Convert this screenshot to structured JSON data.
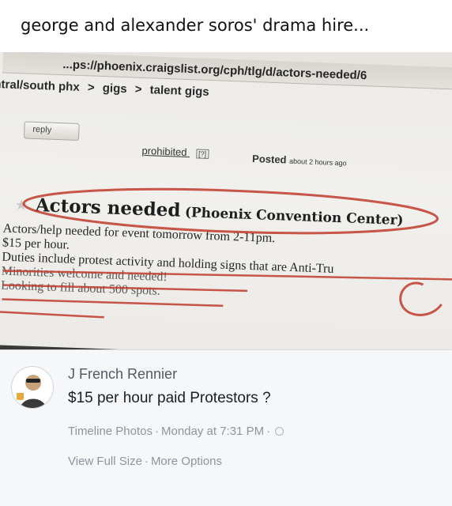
{
  "caption": "george and alexander soros' drama hire...",
  "browser": {
    "url": "...ps://phoenix.craigslist.org/cph/tlg/d/actors-needed/6"
  },
  "craigslist": {
    "breadcrumb": [
      "ntral/south phx",
      ">",
      "gigs",
      ">",
      "talent gigs"
    ],
    "reply_label": "reply",
    "prohibited_label": "prohibited",
    "prohibited_help": "[?]",
    "posted_label": "Posted",
    "posted_ago": "about 2 hours ago",
    "post_title": "Actors needed",
    "post_location": "(Phoenix Convention Center)",
    "body_lines": [
      "Actors/help needed for event tomorrow from 2-11pm.",
      "$15 per hour.",
      "Duties include protest activity and holding signs that are Anti-Tru",
      "Minorities welcome and needed!",
      "Looking to fill about 500 spots."
    ]
  },
  "annotation_color": "#c0392b",
  "facebook": {
    "commenter_name": "J French Rennier",
    "comment_text": "$15 per hour paid Protestors ?",
    "meta": {
      "album": "Timeline Photos",
      "separator": "·",
      "timestamp": "Monday at 7:31 PM",
      "privacy_icon": "globe-icon"
    },
    "links": {
      "view_full_size": "View Full Size",
      "separator": "·",
      "more_options": "More Options"
    }
  }
}
